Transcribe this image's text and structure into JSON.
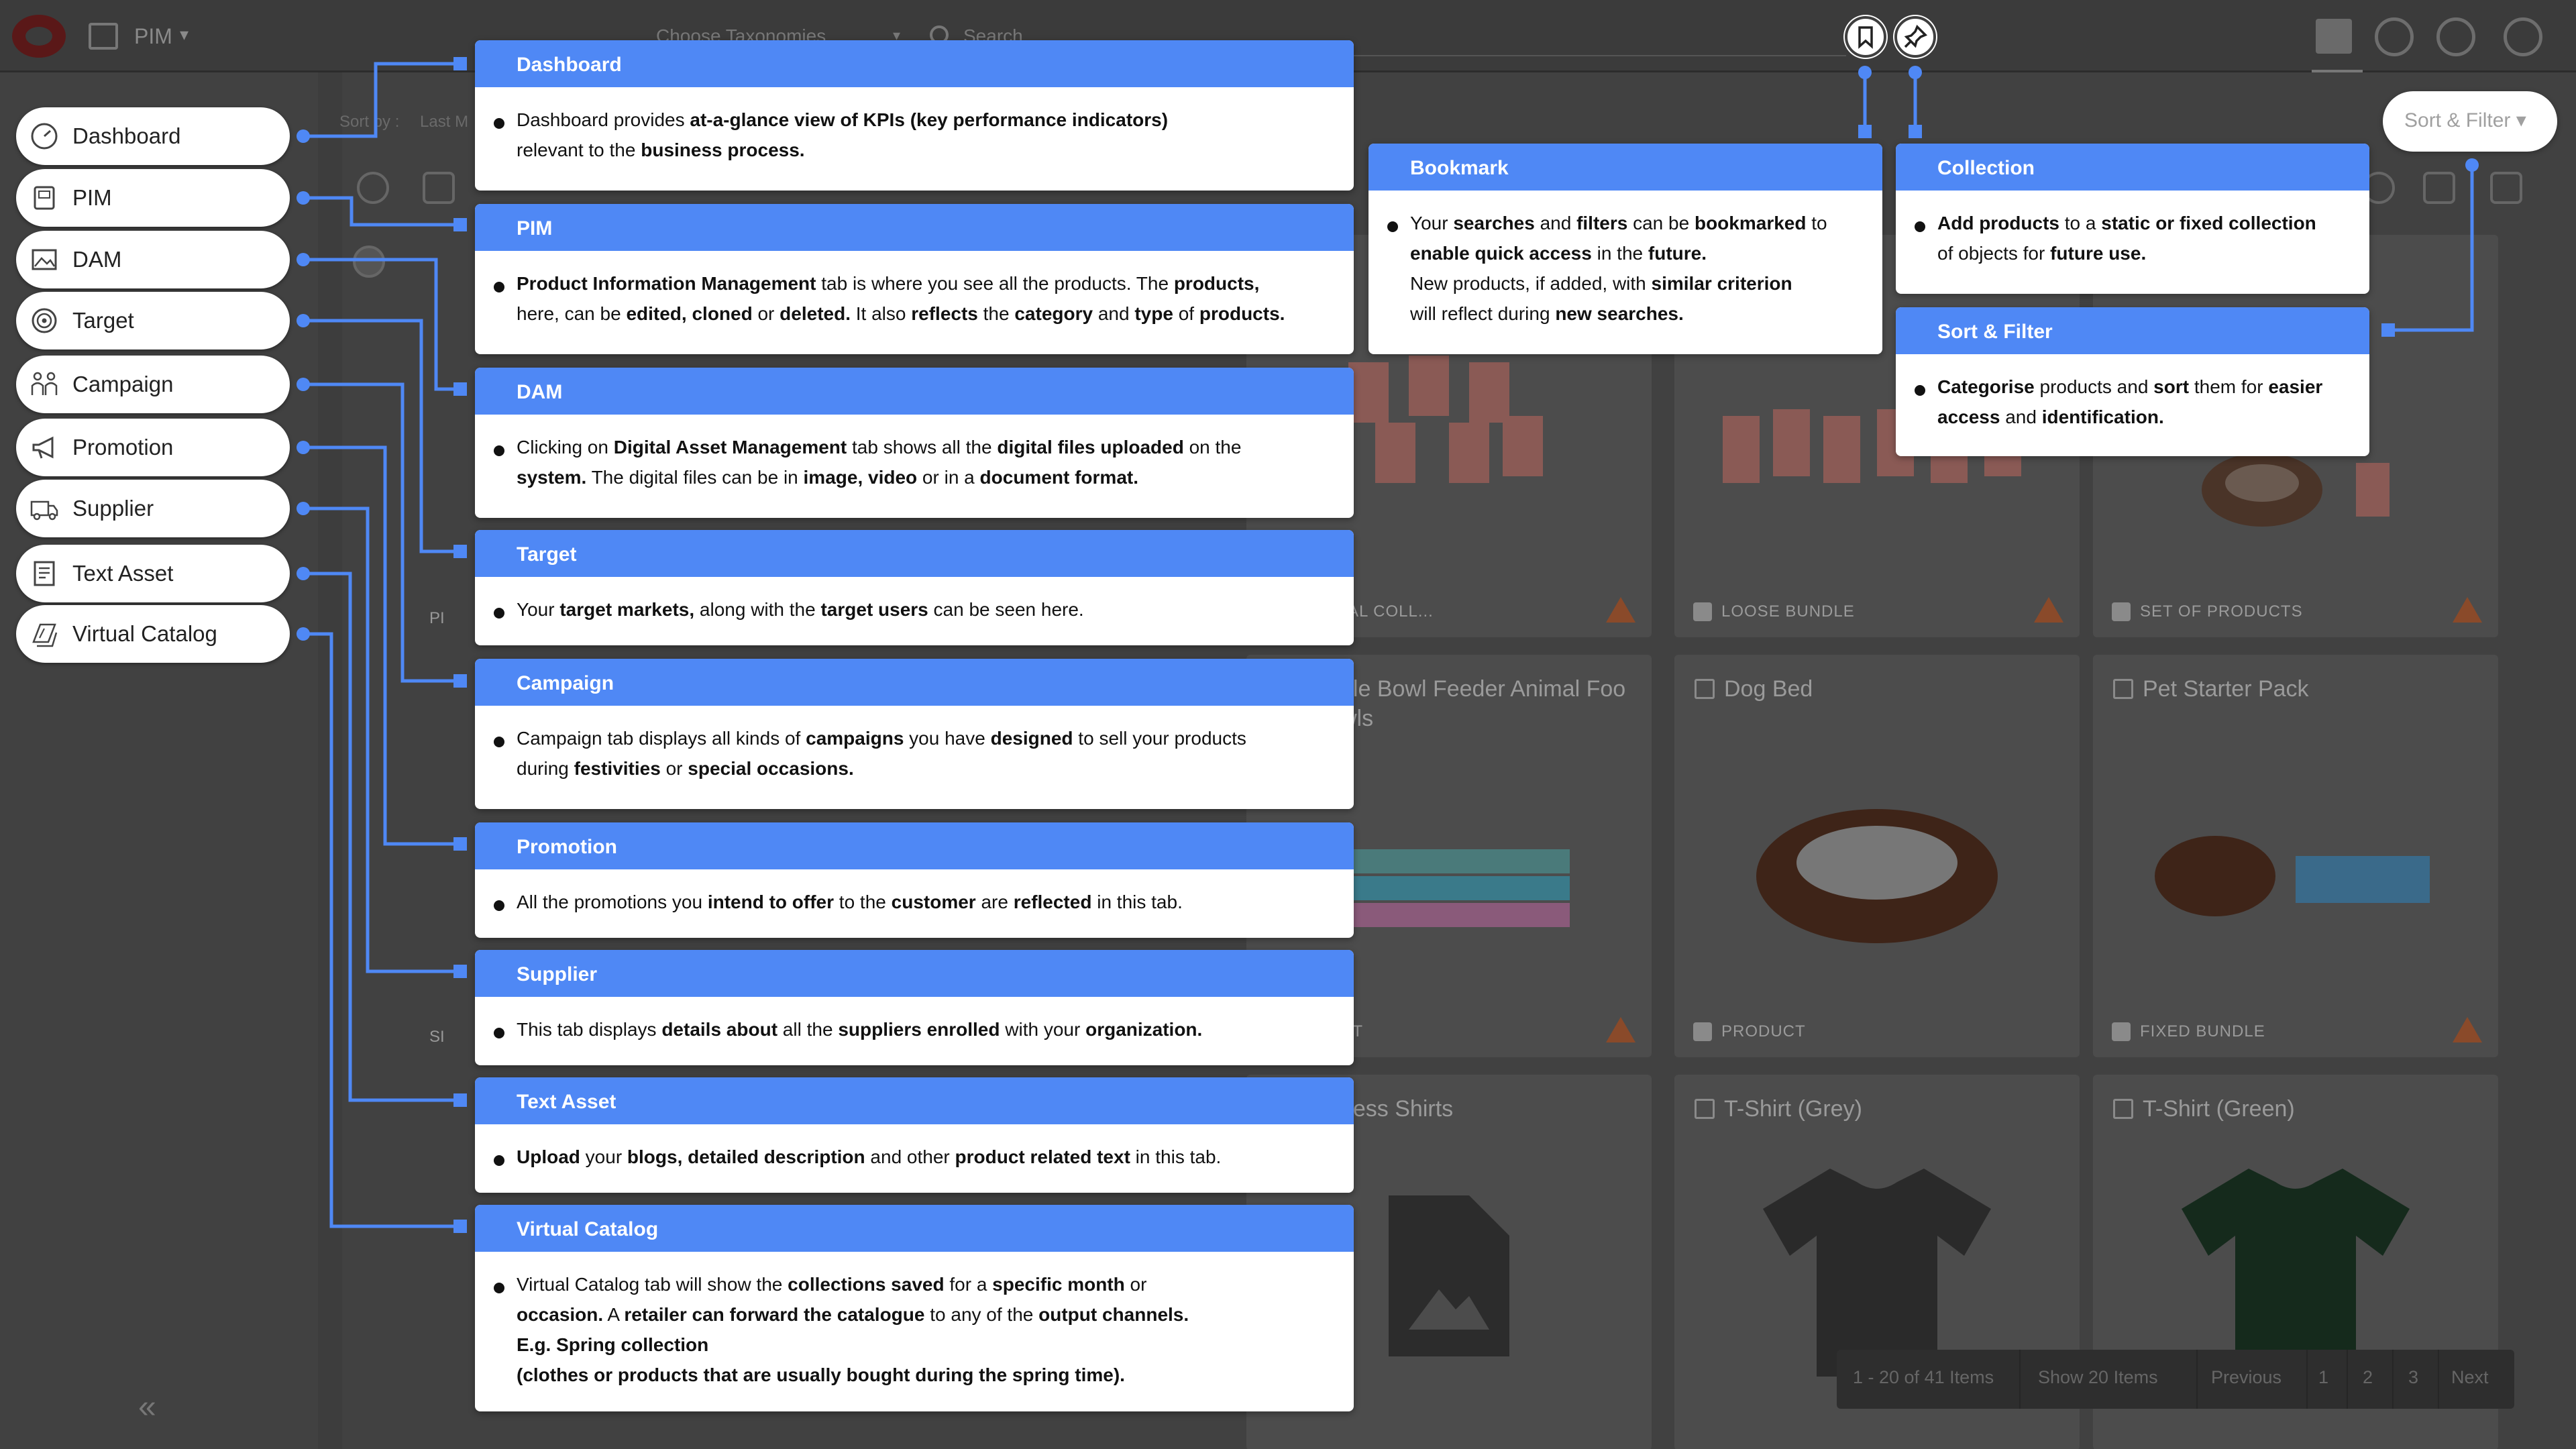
{
  "topbar": {
    "module": "PIM",
    "taxonomy_placeholder": "Choose Taxonomies",
    "search_placeholder": "Search"
  },
  "toolbar": {
    "sort_by_label": "Sort by :",
    "sort_by_value": "Last M"
  },
  "sort_filter_button": "Sort & Filter ▾",
  "nav": [
    {
      "label": "Dashboard",
      "icon": "dashboard-icon"
    },
    {
      "label": "PIM",
      "icon": "pim-icon"
    },
    {
      "label": "DAM",
      "icon": "image-icon"
    },
    {
      "label": "Target",
      "icon": "target-icon"
    },
    {
      "label": "Campaign",
      "icon": "campaign-icon"
    },
    {
      "label": "Promotion",
      "icon": "megaphone-icon"
    },
    {
      "label": "Supplier",
      "icon": "truck-icon"
    },
    {
      "label": "Text Asset",
      "icon": "document-icon"
    },
    {
      "label": "Virtual Catalog",
      "icon": "catalog-icon"
    }
  ],
  "cards": [
    {
      "title": "",
      "type": "OTIONAL COLL...",
      "warn": true
    },
    {
      "title": "",
      "type": "LOOSE BUNDLE",
      "warn": true
    },
    {
      "title": "",
      "type": "SET OF PRODUCTS",
      "warn": true
    },
    {
      "title": "ble Bowl Feeder Animal Foo",
      "title2": "wls",
      "type": "CT",
      "warn": true
    },
    {
      "title": "Dog Bed",
      "type": "PRODUCT",
      "warn": false
    },
    {
      "title": "Pet Starter Pack",
      "type": "FIXED BUNDLE",
      "warn": true
    },
    {
      "title": "rless Shirts",
      "type": "",
      "warn": false
    },
    {
      "title": "T-Shirt (Grey)",
      "type": "",
      "warn": false
    },
    {
      "title": "T-Shirt (Green)",
      "type": "",
      "warn": false
    }
  ],
  "partial_labels": {
    "pi": "PI",
    "si": "SI"
  },
  "pager": {
    "range": "1 - 20 of 41 Items",
    "show": "Show 20 Items",
    "previous": "Previous",
    "p1": "1",
    "p2": "2",
    "p3": "3",
    "next": "Next"
  },
  "tips": {
    "dashboard": {
      "title": "Dashboard"
    },
    "pim": {
      "title": "PIM"
    },
    "dam": {
      "title": "DAM"
    },
    "target": {
      "title": "Target"
    },
    "campaign": {
      "title": "Campaign"
    },
    "promotion": {
      "title": "Promotion"
    },
    "supplier": {
      "title": "Supplier"
    },
    "text_asset": {
      "title": "Text Asset"
    },
    "virtual_catalog": {
      "title": "Virtual Catalog"
    },
    "bookmark": {
      "title": "Bookmark"
    },
    "collection": {
      "title": "Collection"
    },
    "sort_filter": {
      "title": "Sort & Filter"
    }
  },
  "colors": {
    "accent": "#4f88f5",
    "overlay": "#414141"
  }
}
